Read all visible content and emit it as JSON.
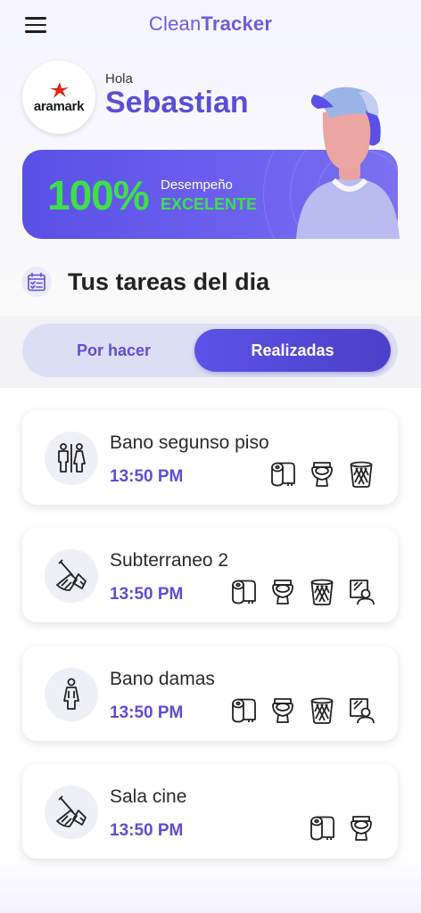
{
  "header": {
    "title_part1": "Clean",
    "title_part2": "Tracker",
    "menu_icon": "hamburger-menu-icon"
  },
  "profile": {
    "logo_text": "aramark",
    "greeting": "Hola",
    "name": "Sebastian"
  },
  "performance": {
    "value": "100%",
    "label": "Desempeño",
    "rating": "EXCELENTE",
    "value_color": "#3ee04a"
  },
  "section": {
    "title": "Tus tareas del dia",
    "icon": "calendar-checklist-icon"
  },
  "tabs": [
    {
      "label": "Por hacer",
      "active": false
    },
    {
      "label": "Realizadas",
      "active": true
    }
  ],
  "tasks": [
    {
      "name": "Bano segunso piso",
      "time": "13:50 PM",
      "icon": "restroom-icon",
      "tools": [
        "toilet-paper-icon",
        "toilet-icon",
        "trash-bin-icon"
      ]
    },
    {
      "name": "Subterraneo 2",
      "time": "13:50 PM",
      "icon": "broom-icon",
      "tools": [
        "toilet-paper-icon",
        "toilet-icon",
        "trash-bin-icon",
        "mirror-person-icon"
      ]
    },
    {
      "name": "Bano damas",
      "time": "13:50 PM",
      "icon": "woman-icon",
      "tools": [
        "toilet-paper-icon",
        "toilet-icon",
        "trash-bin-icon",
        "mirror-person-icon"
      ]
    },
    {
      "name": "Sala cine",
      "time": "13:50 PM",
      "icon": "broom-icon",
      "tools": [
        "toilet-paper-icon",
        "toilet-icon"
      ]
    }
  ],
  "colors": {
    "accent": "#5a4fd6",
    "card_gradient_start": "#5a50e6",
    "success": "#3ee04a"
  }
}
